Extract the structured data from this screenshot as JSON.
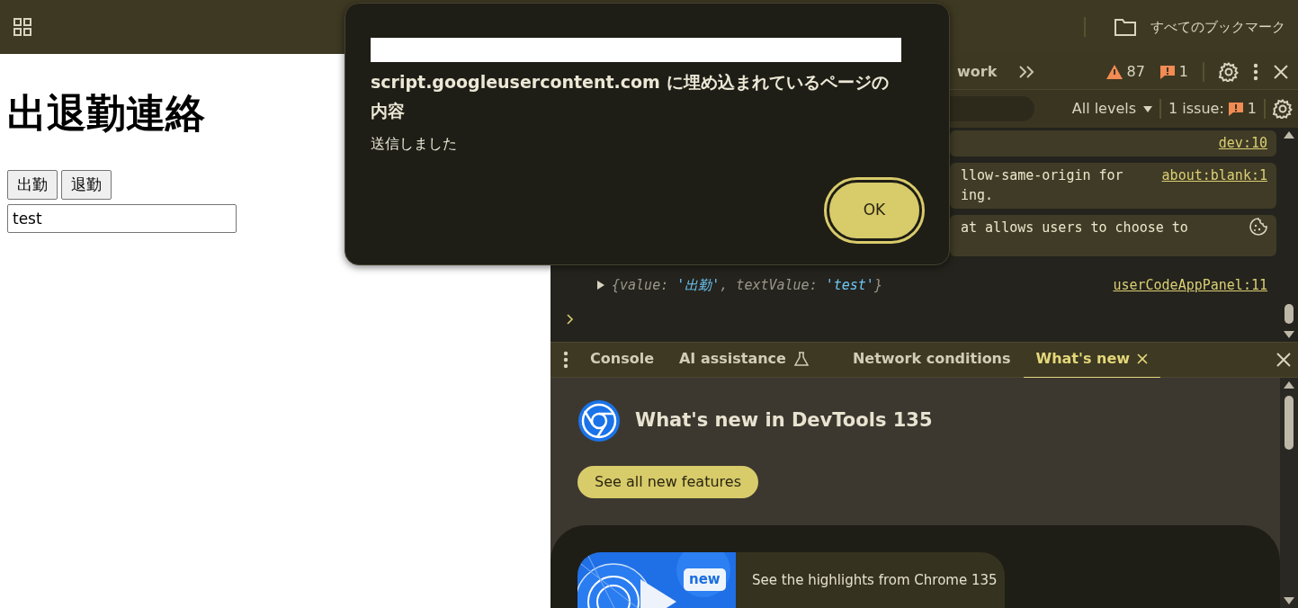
{
  "browser_bar": {
    "bookmarks_label": "すべてのブックマーク"
  },
  "page": {
    "heading": "出退勤連絡",
    "buttons": [
      "出勤",
      "退勤"
    ],
    "input_value": "test"
  },
  "devtools": {
    "tabs": [
      {
        "label": "work",
        "selected": false
      }
    ],
    "warnings": "87",
    "errors": "1",
    "filter": {
      "levels": "All levels",
      "issues_label": "1 issue:",
      "issues_count": "1"
    },
    "messages": [
      {
        "kind": "notice",
        "source": "dev:10"
      },
      {
        "kind": "notice",
        "lines": [
          "llow-same-origin for",
          "ing."
        ],
        "source": "about:blank:1"
      },
      {
        "kind": "cookie",
        "lines": [
          "at allows users to choose to"
        ]
      },
      {
        "kind": "log",
        "segments": [
          {
            "text": "{value: ",
            "kind": "key"
          },
          {
            "text": "'出勤'",
            "kind": "string"
          },
          {
            "text": ", textValue: ",
            "kind": "key"
          },
          {
            "text": "'test'",
            "kind": "string"
          },
          {
            "text": "}",
            "kind": "key"
          }
        ],
        "source": "userCodeAppPanel:11"
      }
    ],
    "drawer_tabs": [
      {
        "label": "Console",
        "kind": "plain",
        "selected": false
      },
      {
        "label": "AI assistance",
        "kind": "experimental",
        "selected": false
      },
      {
        "label": "Network conditions",
        "kind": "plain",
        "selected": false
      },
      {
        "label": "What's new",
        "kind": "closable",
        "selected": true
      }
    ],
    "whats_new": {
      "title": "What's new in DevTools 135",
      "button": "See all new features",
      "card": {
        "badge": "new",
        "text": "See the highlights from Chrome 135"
      }
    }
  },
  "dialog": {
    "origin": "script.googleusercontent.com に埋め込まれているページの内容",
    "message": "送信しました",
    "button": "OK"
  }
}
